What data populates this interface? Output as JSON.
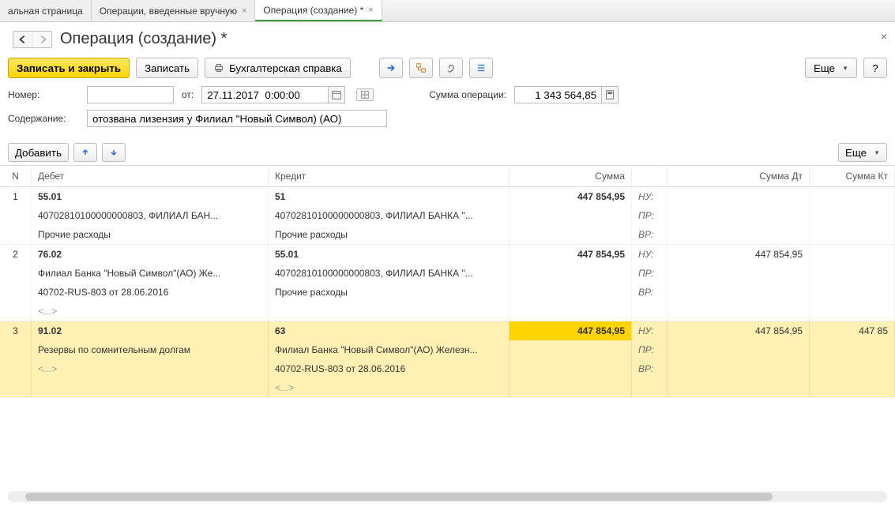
{
  "tabs": [
    {
      "label": "альная страница",
      "closable": false
    },
    {
      "label": "Операции, введенные вручную",
      "closable": true
    },
    {
      "label": "Операция (создание) *",
      "closable": true,
      "active": true
    }
  ],
  "page_title": "Операция (создание) *",
  "toolbar": {
    "save_close": "Записать и закрыть",
    "save": "Записать",
    "reference": "Бухгалтерская справка",
    "more": "Еще"
  },
  "form": {
    "number_label": "Номер:",
    "number_value": "",
    "from_label": "от:",
    "date_value": "27.11.2017  0:00:00",
    "sum_label": "Сумма операции:",
    "sum_value": "1 343 564,85",
    "content_label": "Содержание:",
    "content_value": "отозвана лизензия у Филиал \"Новый Символ) (АО)"
  },
  "table_toolbar": {
    "add": "Добавить",
    "more": "Еще"
  },
  "grid": {
    "headers": {
      "n": "N",
      "debit": "Дебет",
      "credit": "Кредит",
      "sum": "Сумма",
      "sum_dt": "Сумма Дт",
      "sum_kt": "Сумма Кт"
    },
    "row_labels": [
      "НУ:",
      "ПР:",
      "ВР:"
    ],
    "rows": [
      {
        "n": "1",
        "debit": [
          "55.01",
          "40702810100000000803, ФИЛИАЛ БАН...",
          "Прочие расходы"
        ],
        "credit": [
          "51",
          "40702810100000000803, ФИЛИАЛ БАНКА \"...",
          "Прочие расходы"
        ],
        "sum": "447 854,95",
        "dt": [
          "",
          "",
          ""
        ],
        "kt": [
          "",
          "",
          ""
        ],
        "selected": false
      },
      {
        "n": "2",
        "debit": [
          "76.02",
          "Филиал Банка \"Новый Символ\"(АО) Же...",
          "40702-RUS-803 от 28.06.2016",
          "<...>"
        ],
        "credit": [
          "55.01",
          "40702810100000000803, ФИЛИАЛ БАНКА \"...",
          "Прочие расходы",
          ""
        ],
        "sum": "447 854,95",
        "dt": [
          "447 854,95",
          "",
          ""
        ],
        "kt": [
          "",
          "",
          ""
        ],
        "selected": false
      },
      {
        "n": "3",
        "debit": [
          "91.02",
          "Резервы по сомнительным долгам",
          "<...>",
          ""
        ],
        "credit": [
          "63",
          "Филиал Банка \"Новый Символ\"(АО) Железн...",
          "40702-RUS-803 от 28.06.2016",
          "<...>"
        ],
        "sum": "447 854,95",
        "dt": [
          "447 854,95",
          "",
          ""
        ],
        "kt": [
          "447 85",
          "",
          ""
        ],
        "selected": true,
        "highlight_sum": true
      }
    ]
  }
}
